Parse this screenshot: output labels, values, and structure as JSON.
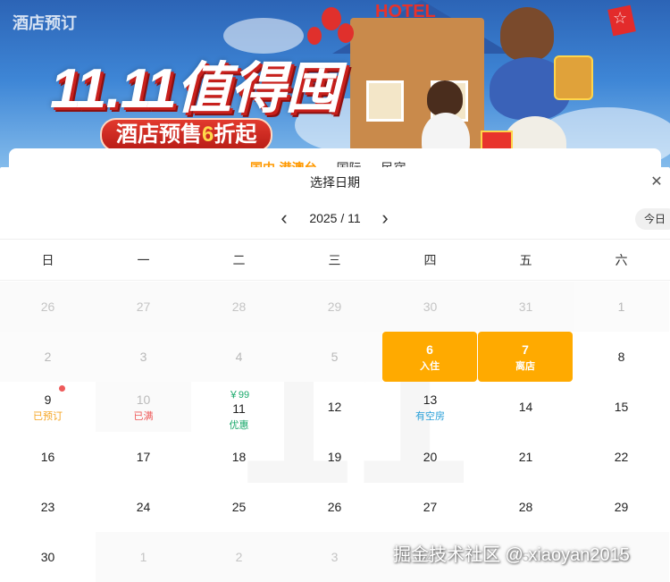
{
  "banner": {
    "title": "酒店预订",
    "headline": "11.11值得囤",
    "sub_prefix": "酒店预售",
    "sub_highlight": "6",
    "sub_suffix": "折起",
    "sign": "HOTEL"
  },
  "behind": {
    "tabs": [
      "国内·港澳台",
      "国际",
      "民宿"
    ]
  },
  "calendar": {
    "title": "选择日期",
    "close_icon": "close-icon",
    "month_label": "2025 / 11",
    "today_label": "今日",
    "weekdays": [
      "日",
      "一",
      "二",
      "三",
      "四",
      "五",
      "六"
    ],
    "watermark": "11",
    "rows": [
      [
        {
          "num": "26",
          "kind": "other"
        },
        {
          "num": "27",
          "kind": "other"
        },
        {
          "num": "28",
          "kind": "other"
        },
        {
          "num": "29",
          "kind": "other"
        },
        {
          "num": "30",
          "kind": "other"
        },
        {
          "num": "31",
          "kind": "other"
        },
        {
          "num": "1",
          "kind": "past"
        }
      ],
      [
        {
          "num": "2",
          "kind": "past"
        },
        {
          "num": "3",
          "kind": "past"
        },
        {
          "num": "4",
          "kind": "past"
        },
        {
          "num": "5",
          "kind": "past"
        },
        {
          "num": "6",
          "kind": "sel",
          "tag": "入住"
        },
        {
          "num": "7",
          "kind": "sel",
          "tag": "离店"
        },
        {
          "num": "8",
          "kind": "normal"
        }
      ],
      [
        {
          "num": "9",
          "kind": "booked",
          "tag": "已预订",
          "dot": true
        },
        {
          "num": "10",
          "kind": "full",
          "tag": "已满"
        },
        {
          "num": "11",
          "kind": "promo",
          "top": "￥99",
          "tag": "优惠"
        },
        {
          "num": "12",
          "kind": "normal"
        },
        {
          "num": "13",
          "kind": "avail",
          "tag": "有空房"
        },
        {
          "num": "14",
          "kind": "normal"
        },
        {
          "num": "15",
          "kind": "normal"
        }
      ],
      [
        {
          "num": "16",
          "kind": "normal"
        },
        {
          "num": "17",
          "kind": "normal"
        },
        {
          "num": "18",
          "kind": "normal"
        },
        {
          "num": "19",
          "kind": "normal"
        },
        {
          "num": "20",
          "kind": "normal"
        },
        {
          "num": "21",
          "kind": "normal"
        },
        {
          "num": "22",
          "kind": "normal"
        }
      ],
      [
        {
          "num": "23",
          "kind": "normal"
        },
        {
          "num": "24",
          "kind": "normal"
        },
        {
          "num": "25",
          "kind": "normal"
        },
        {
          "num": "26",
          "kind": "normal"
        },
        {
          "num": "27",
          "kind": "normal"
        },
        {
          "num": "28",
          "kind": "normal"
        },
        {
          "num": "29",
          "kind": "normal"
        }
      ],
      [
        {
          "num": "30",
          "kind": "normal"
        },
        {
          "num": "1",
          "kind": "other"
        },
        {
          "num": "2",
          "kind": "other"
        },
        {
          "num": "3",
          "kind": "other"
        },
        {
          "num": "4",
          "kind": "other"
        },
        {
          "num": "5",
          "kind": "other"
        },
        {
          "num": "6",
          "kind": "other"
        }
      ]
    ]
  },
  "colors": {
    "selected": "#ffaa00",
    "booked": "#f5a623",
    "full": "#ee5a5a",
    "promo": "#1aa96b",
    "available": "#2aa0d8"
  },
  "watermark_text": "掘金技术社区 @ xiaoyan2015"
}
